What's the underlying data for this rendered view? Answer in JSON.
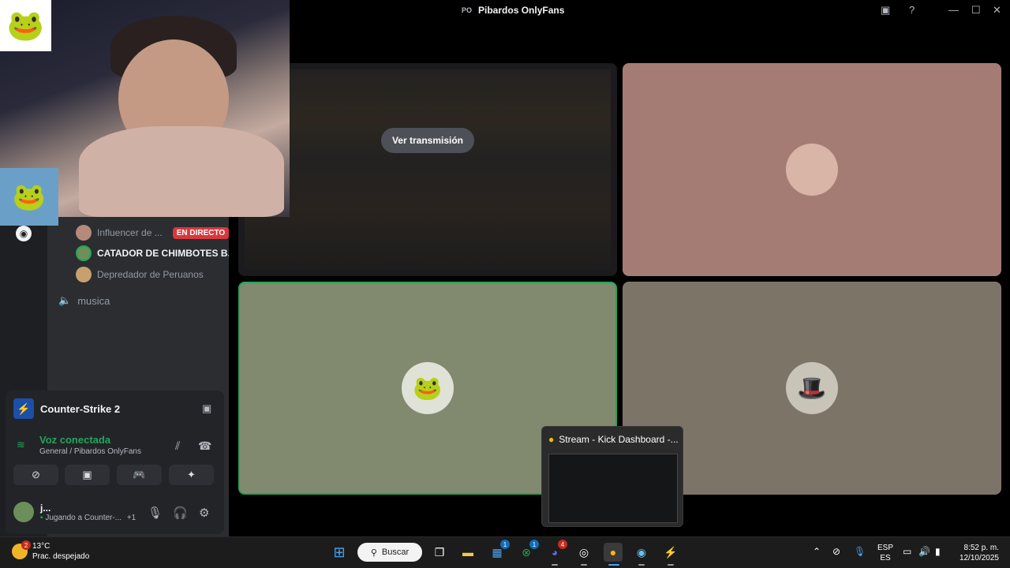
{
  "window": {
    "server_badge": "PO",
    "title": "Pibardos OnlyFans"
  },
  "sidebar": {
    "members": [
      {
        "name": "Influencer de ...",
        "badge": "EN DIRECTO"
      },
      {
        "name": "CATADOR DE CHIMBOTES B..."
      },
      {
        "name": "Depredador de Peruanos"
      }
    ],
    "voice_channel": "musica"
  },
  "activity": {
    "game": "Counter-Strike 2",
    "voice_status": "Voz conectada",
    "voice_path": "General / Pibardos OnlyFans"
  },
  "user": {
    "name": "j...",
    "status": "Jugando a Counter-...",
    "extra": "+1"
  },
  "stage": {
    "view_stream_label": "Ver transmisión"
  },
  "preview": {
    "title": "Stream - Kick Dashboard -..."
  },
  "taskbar": {
    "weather_badge": "2",
    "temperature": "13°C",
    "condition": "Prac. despejado",
    "search_label": "Buscar",
    "badges": {
      "store": "1",
      "xbox": "1",
      "discord": "4"
    },
    "lang_top": "ESP",
    "lang_bottom": "ES",
    "time": "8:52 p. m.",
    "date": "12/10/2025"
  },
  "colors": {
    "live": "#da373c",
    "voice_connected": "#23a55a",
    "speaking_border": "#23a55a"
  }
}
